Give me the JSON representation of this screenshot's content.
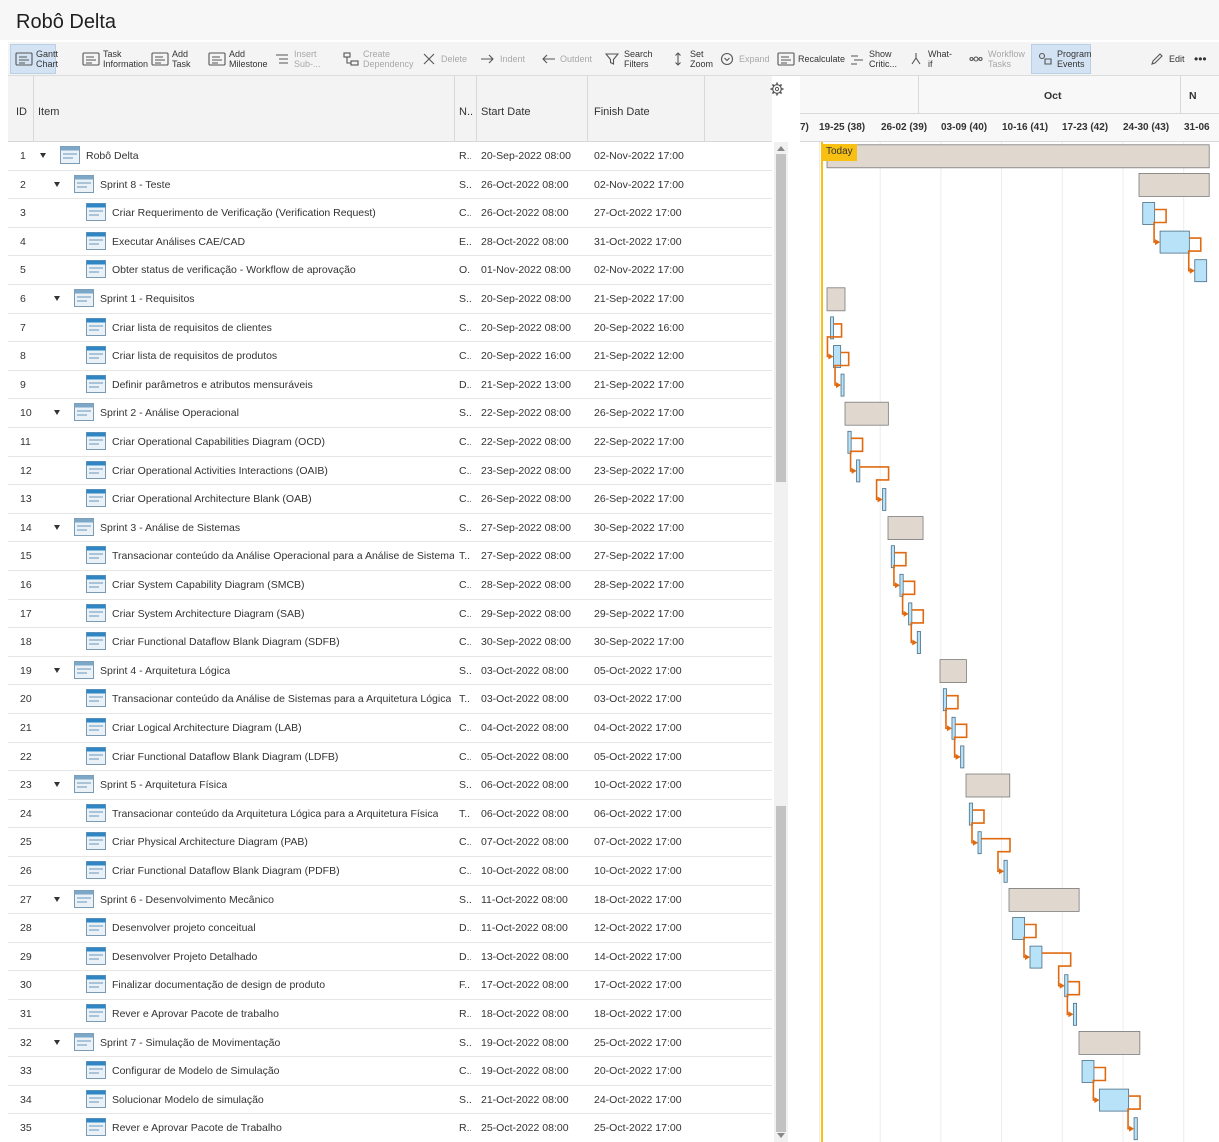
{
  "app": {
    "title": "Robô Delta"
  },
  "toolbar": [
    {
      "label": "Gantt\nChart",
      "icon": "gantt-chart-icon",
      "active": true,
      "disabled": false
    },
    {
      "label": "Task\nInformation",
      "icon": "task-information-icon",
      "active": false,
      "disabled": false
    },
    {
      "label": "Add\nTask",
      "icon": "add-task-icon",
      "active": false,
      "disabled": false
    },
    {
      "label": "Add\nMilestone",
      "icon": "add-milestone-icon",
      "active": false,
      "disabled": false
    },
    {
      "label": "Insert\nSub-...",
      "icon": "insert-sub-icon",
      "active": false,
      "disabled": true
    },
    {
      "label": "Create\nDependency",
      "icon": "create-dependency-icon",
      "active": false,
      "disabled": true
    },
    {
      "label": "Delete",
      "icon": "delete-icon",
      "active": false,
      "disabled": true
    },
    {
      "label": "Indent",
      "icon": "indent-icon",
      "active": false,
      "disabled": true
    },
    {
      "label": "Outdent",
      "icon": "outdent-icon",
      "active": false,
      "disabled": true
    },
    {
      "label": "Search\nFilters",
      "icon": "filter-icon",
      "active": false,
      "disabled": false
    },
    {
      "label": "Set\nZoom",
      "icon": "zoom-icon",
      "active": false,
      "disabled": false
    },
    {
      "label": "Expand",
      "icon": "expand-icon",
      "active": false,
      "disabled": true
    },
    {
      "label": "Recalculate",
      "icon": "recalculate-icon",
      "active": false,
      "disabled": false
    },
    {
      "label": "Show\nCritic...",
      "icon": "critical-path-icon",
      "active": false,
      "disabled": false
    },
    {
      "label": "What-\nif",
      "icon": "what-if-icon",
      "active": false,
      "disabled": false
    },
    {
      "label": "Workflow\nTasks",
      "icon": "workflow-tasks-icon",
      "active": false,
      "disabled": true
    },
    {
      "label": "Program\nEvents",
      "icon": "program-events-icon",
      "active": true,
      "disabled": false
    },
    {
      "label": "Edit",
      "icon": "edit-icon",
      "active": false,
      "disabled": false
    },
    {
      "label": "•••",
      "icon": "more-icon",
      "active": false,
      "disabled": false
    }
  ],
  "grid": {
    "columns": {
      "id": "ID",
      "item": "Item",
      "n": "N..",
      "start": "Start Date",
      "finish": "Finish Date"
    },
    "rows": [
      {
        "id": "1",
        "level": 0,
        "parent": true,
        "name": "Robô Delta",
        "n": "R...",
        "start": "20-Sep-2022 08:00",
        "finish": "02-Nov-2022 17:00"
      },
      {
        "id": "2",
        "level": 1,
        "parent": true,
        "name": "Sprint 8 - Teste",
        "n": "S...",
        "start": "26-Oct-2022 08:00",
        "finish": "02-Nov-2022 17:00"
      },
      {
        "id": "3",
        "level": 2,
        "parent": false,
        "name": "Criar Requerimento de Verificação (Verification Request)",
        "n": "C...",
        "start": "26-Oct-2022 08:00",
        "finish": "27-Oct-2022 17:00"
      },
      {
        "id": "4",
        "level": 2,
        "parent": false,
        "name": "Executar Análises CAE/CAD",
        "n": "E...",
        "start": "28-Oct-2022 08:00",
        "finish": "31-Oct-2022 17:00"
      },
      {
        "id": "5",
        "level": 2,
        "parent": false,
        "name": "Obter status de verificação - Workflow de aprovação",
        "n": "O...",
        "start": "01-Nov-2022 08:00",
        "finish": "02-Nov-2022 17:00"
      },
      {
        "id": "6",
        "level": 1,
        "parent": true,
        "name": "Sprint 1 - Requisitos",
        "n": "S...",
        "start": "20-Sep-2022 08:00",
        "finish": "21-Sep-2022 17:00"
      },
      {
        "id": "7",
        "level": 2,
        "parent": false,
        "name": "Criar lista de requisitos de clientes",
        "n": "C...",
        "start": "20-Sep-2022 08:00",
        "finish": "20-Sep-2022 16:00"
      },
      {
        "id": "8",
        "level": 2,
        "parent": false,
        "name": "Criar lista de requisitos de produtos",
        "n": "C...",
        "start": "20-Sep-2022 16:00",
        "finish": "21-Sep-2022 12:00"
      },
      {
        "id": "9",
        "level": 2,
        "parent": false,
        "name": "Definir parâmetros e atributos mensuráveis",
        "n": "D...",
        "start": "21-Sep-2022 13:00",
        "finish": "21-Sep-2022 17:00"
      },
      {
        "id": "10",
        "level": 1,
        "parent": true,
        "name": "Sprint 2 - Análise Operacional",
        "n": "S...",
        "start": "22-Sep-2022 08:00",
        "finish": "26-Sep-2022 17:00"
      },
      {
        "id": "11",
        "level": 2,
        "parent": false,
        "name": "Criar Operational Capabilities Diagram (OCD)",
        "n": "C...",
        "start": "22-Sep-2022 08:00",
        "finish": "22-Sep-2022 17:00"
      },
      {
        "id": "12",
        "level": 2,
        "parent": false,
        "name": "Criar Operational Activities Interactions (OAIB)",
        "n": "C...",
        "start": "23-Sep-2022 08:00",
        "finish": "23-Sep-2022 17:00"
      },
      {
        "id": "13",
        "level": 2,
        "parent": false,
        "name": "Criar Operational Architecture Blank (OAB)",
        "n": "C...",
        "start": "26-Sep-2022 08:00",
        "finish": "26-Sep-2022 17:00"
      },
      {
        "id": "14",
        "level": 1,
        "parent": true,
        "name": "Sprint 3 - Análise de Sistemas",
        "n": "S...",
        "start": "27-Sep-2022 08:00",
        "finish": "30-Sep-2022 17:00"
      },
      {
        "id": "15",
        "level": 2,
        "parent": false,
        "name": "Transacionar conteúdo da Análise Operacional para a Análise de Sistemas",
        "n": "T...",
        "start": "27-Sep-2022 08:00",
        "finish": "27-Sep-2022 17:00"
      },
      {
        "id": "16",
        "level": 2,
        "parent": false,
        "name": "Criar System Capability Diagram (SMCB)",
        "n": "C...",
        "start": "28-Sep-2022 08:00",
        "finish": "28-Sep-2022 17:00"
      },
      {
        "id": "17",
        "level": 2,
        "parent": false,
        "name": "Criar System Architecture Diagram (SAB)",
        "n": "C...",
        "start": "29-Sep-2022 08:00",
        "finish": "29-Sep-2022 17:00"
      },
      {
        "id": "18",
        "level": 2,
        "parent": false,
        "name": "Criar Functional Dataflow Blank Diagram (SDFB)",
        "n": "C...",
        "start": "30-Sep-2022 08:00",
        "finish": "30-Sep-2022 17:00"
      },
      {
        "id": "19",
        "level": 1,
        "parent": true,
        "name": "Sprint 4 - Arquitetura Lógica",
        "n": "S...",
        "start": "03-Oct-2022 08:00",
        "finish": "05-Oct-2022 17:00"
      },
      {
        "id": "20",
        "level": 2,
        "parent": false,
        "name": "Transacionar conteúdo da Análise de Sistemas para a Arquitetura Lógica",
        "n": "T...",
        "start": "03-Oct-2022 08:00",
        "finish": "03-Oct-2022 17:00"
      },
      {
        "id": "21",
        "level": 2,
        "parent": false,
        "name": "Criar Logical Architecture Diagram (LAB)",
        "n": "C...",
        "start": "04-Oct-2022 08:00",
        "finish": "04-Oct-2022 17:00"
      },
      {
        "id": "22",
        "level": 2,
        "parent": false,
        "name": "Criar Functional Dataflow Blank Diagram (LDFB)",
        "n": "C...",
        "start": "05-Oct-2022 08:00",
        "finish": "05-Oct-2022 17:00"
      },
      {
        "id": "23",
        "level": 1,
        "parent": true,
        "name": "Sprint 5 - Arquitetura Física",
        "n": "S...",
        "start": "06-Oct-2022 08:00",
        "finish": "10-Oct-2022 17:00"
      },
      {
        "id": "24",
        "level": 2,
        "parent": false,
        "name": "Transacionar conteúdo da Arquitetura Lógica para a Arquitetura Física",
        "n": "T...",
        "start": "06-Oct-2022 08:00",
        "finish": "06-Oct-2022 17:00"
      },
      {
        "id": "25",
        "level": 2,
        "parent": false,
        "name": "Criar Physical Architecture Diagram (PAB)",
        "n": "C...",
        "start": "07-Oct-2022 08:00",
        "finish": "07-Oct-2022 17:00"
      },
      {
        "id": "26",
        "level": 2,
        "parent": false,
        "name": "Criar Functional Dataflow Blank Diagram (PDFB)",
        "n": "C...",
        "start": "10-Oct-2022 08:00",
        "finish": "10-Oct-2022 17:00"
      },
      {
        "id": "27",
        "level": 1,
        "parent": true,
        "name": "Sprint 6 - Desenvolvimento Mecânico",
        "n": "S...",
        "start": "11-Oct-2022 08:00",
        "finish": "18-Oct-2022 17:00"
      },
      {
        "id": "28",
        "level": 2,
        "parent": false,
        "name": "Desenvolver projeto conceitual",
        "n": "D...",
        "start": "11-Oct-2022 08:00",
        "finish": "12-Oct-2022 17:00"
      },
      {
        "id": "29",
        "level": 2,
        "parent": false,
        "name": "Desenvolver Projeto Detalhado",
        "n": "D...",
        "start": "13-Oct-2022 08:00",
        "finish": "14-Oct-2022 17:00"
      },
      {
        "id": "30",
        "level": 2,
        "parent": false,
        "name": "Finalizar documentação de design de produto",
        "n": "F...",
        "start": "17-Oct-2022 08:00",
        "finish": "17-Oct-2022 17:00"
      },
      {
        "id": "31",
        "level": 2,
        "parent": false,
        "name": "Rever e Aprovar Pacote de trabalho",
        "n": "R...",
        "start": "18-Oct-2022 08:00",
        "finish": "18-Oct-2022 17:00"
      },
      {
        "id": "32",
        "level": 1,
        "parent": true,
        "name": "Sprint 7 - Simulação de Movimentação",
        "n": "S...",
        "start": "19-Oct-2022 08:00",
        "finish": "25-Oct-2022 17:00"
      },
      {
        "id": "33",
        "level": 2,
        "parent": false,
        "name": "Configurar de Modelo de Simulação",
        "n": "C...",
        "start": "19-Oct-2022 08:00",
        "finish": "20-Oct-2022 17:00"
      },
      {
        "id": "34",
        "level": 2,
        "parent": false,
        "name": "Solucionar Modelo de simulação",
        "n": "S...",
        "start": "21-Oct-2022 08:00",
        "finish": "24-Oct-2022 17:00"
      },
      {
        "id": "35",
        "level": 2,
        "parent": false,
        "name": "Rever e Aprovar Pacote de Trabalho",
        "n": "R...",
        "start": "25-Oct-2022 08:00",
        "finish": "25-Oct-2022 17:00"
      }
    ]
  },
  "gantt": {
    "months": [
      "Oct",
      "N"
    ],
    "weeks": [
      "7)",
      "19-25 (38)",
      "26-02 (39)",
      "03-09 (40)",
      "10-16 (41)",
      "17-23 (42)",
      "24-30 (43)",
      "31-06"
    ],
    "today_label": "Today",
    "colors": {
      "summary": "#e0d8cf",
      "task": "#b8e2f7",
      "link": "#e06a10",
      "today": "#f7c012"
    },
    "dependencies": [
      [
        3,
        4
      ],
      [
        4,
        5
      ],
      [
        7,
        8
      ],
      [
        8,
        9
      ],
      [
        11,
        12
      ],
      [
        12,
        13
      ],
      [
        15,
        16
      ],
      [
        16,
        17
      ],
      [
        17,
        18
      ],
      [
        20,
        21
      ],
      [
        21,
        22
      ],
      [
        24,
        25
      ],
      [
        25,
        26
      ],
      [
        28,
        29
      ],
      [
        29,
        30
      ],
      [
        30,
        31
      ],
      [
        33,
        34
      ],
      [
        34,
        35
      ]
    ]
  }
}
